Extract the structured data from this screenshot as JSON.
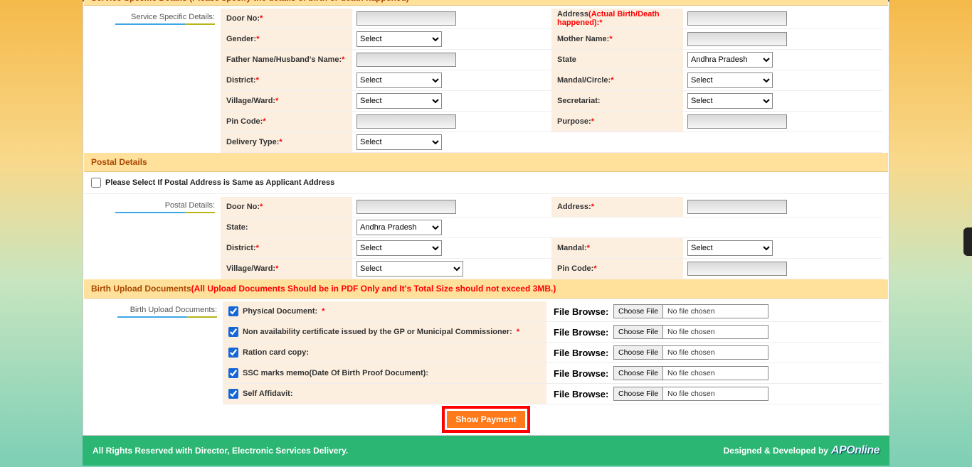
{
  "service_header": {
    "title": "Service Specific Details (Please specify the details of birth or death happened)"
  },
  "service": {
    "side_label": "Service Specific Details:",
    "door_no": {
      "label": "Door No:"
    },
    "gender": {
      "label": "Gender:",
      "selected": "Select"
    },
    "father_husband": {
      "label": "Father Name/Husband's Name:"
    },
    "district": {
      "label": "District:",
      "selected": "Select"
    },
    "village_ward": {
      "label": "Village/Ward:",
      "selected": "Select"
    },
    "pin": {
      "label": "Pin Code:"
    },
    "delivery_type": {
      "label": "Delivery Type:",
      "selected": "Select"
    },
    "address": {
      "label": "Address",
      "hint": "(Actual Birth/Death happened):"
    },
    "mother_name": {
      "label": "Mother Name:"
    },
    "state": {
      "label": "State",
      "selected": "Andhra Pradesh"
    },
    "mandal": {
      "label": "Mandal/Circle:",
      "selected": "Select"
    },
    "secretariat": {
      "label": "Secretariat:",
      "selected": "Select"
    },
    "purpose": {
      "label": "Purpose:"
    }
  },
  "postal_header": {
    "title": "Postal Details"
  },
  "postal": {
    "same_as_applicant": "Please Select If Postal Address is Same as Applicant Address",
    "side_label": "Postal Details:",
    "door_no": {
      "label": "Door No:"
    },
    "state": {
      "label": "State:",
      "selected": "Andhra Pradesh"
    },
    "district": {
      "label": "District:",
      "selected": "Select"
    },
    "village_ward": {
      "label": "Village/Ward:",
      "selected": "Select"
    },
    "address": {
      "label": "Address:"
    },
    "mandal": {
      "label": "Mandal:",
      "selected": "Select"
    },
    "pin": {
      "label": "Pin Code:"
    }
  },
  "upload_header": {
    "title": "Birth Upload Documents",
    "hint": "(All Upload Documents Should be in PDF Only and It's Total Size should not exceed 3MB.)"
  },
  "uploads": {
    "side_label": "Birth Upload Documents:",
    "file_browse_label": "File Browse",
    "choose_btn": "Choose File",
    "no_file": "No file chosen",
    "items": [
      {
        "label": "Physical Document:",
        "required": true,
        "checked": true
      },
      {
        "label": "Non availability certificate issued by the GP or Municipal Commissioner:",
        "required": true,
        "checked": true
      },
      {
        "label": "Ration card copy:",
        "required": false,
        "checked": true
      },
      {
        "label": "SSC marks memo(Date Of Birth Proof Document):",
        "required": false,
        "checked": true
      },
      {
        "label": "Self Affidavit:",
        "required": false,
        "checked": true
      }
    ]
  },
  "actions": {
    "show_payment": "Show Payment"
  },
  "footer": {
    "left": "All Rights Reserved with Director, Electronic Services Delivery.",
    "right": "Designed & Developed by",
    "brand": "APOnline"
  }
}
